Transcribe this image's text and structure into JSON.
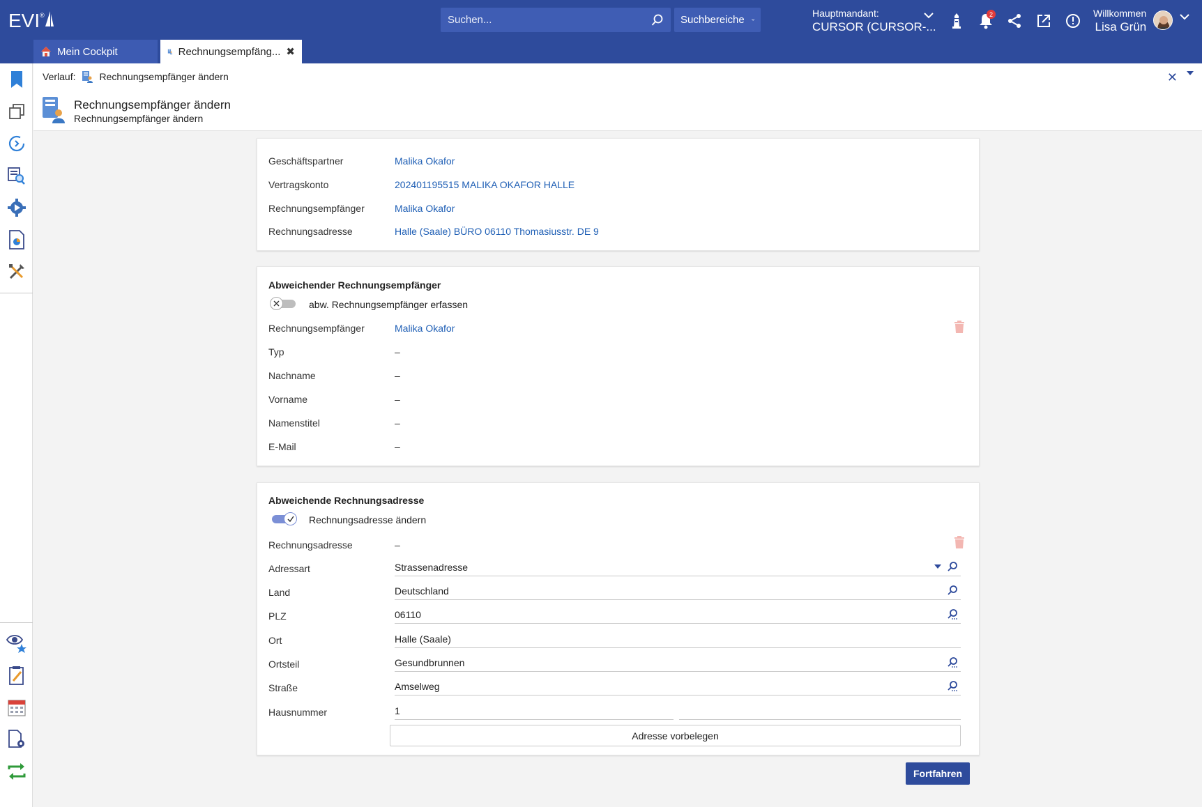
{
  "app": {
    "logo_text": "EVI",
    "logo_reg": "®",
    "search_placeholder": "Suchen...",
    "search_scope_label": "Suchbereiche",
    "mandant_label": "Hauptmandant:",
    "mandant_value": "CURSOR (CURSOR-...",
    "notification_count": "2",
    "welcome_label": "Willkommen",
    "user_name": "Lisa Grün"
  },
  "tabs": [
    {
      "label": "Mein Cockpit"
    },
    {
      "label": "Rechnungsempfäng..."
    }
  ],
  "header": {
    "breadcrumb_label": "Verlauf:",
    "breadcrumb_item": "Rechnungsempfänger ändern",
    "title": "Rechnungsempfänger ändern",
    "subtitle": "Rechnungsempfänger ändern"
  },
  "summary": {
    "rows": [
      {
        "label": "Geschäftspartner",
        "value": "Malika Okafor"
      },
      {
        "label": "Vertragskonto",
        "value": "202401195515 MALIKA OKAFOR HALLE"
      },
      {
        "label": "Rechnungsempfänger",
        "value": "Malika Okafor"
      },
      {
        "label": "Rechnungsadresse",
        "value": "Halle (Saale) BÜRO 06110 Thomasiusstr. DE 9"
      }
    ]
  },
  "recipient": {
    "title": "Abweichender Rechnungsempfänger",
    "toggle_label": "abw. Rechnungsempfänger erfassen",
    "toggle_on": false,
    "recipient_label": "Rechnungsempfänger",
    "recipient_value": "Malika Okafor",
    "rows": [
      {
        "label": "Typ",
        "value": "–"
      },
      {
        "label": "Nachname",
        "value": "–"
      },
      {
        "label": "Vorname",
        "value": "–"
      },
      {
        "label": "Namenstitel",
        "value": "–"
      },
      {
        "label": "E-Mail",
        "value": "–"
      }
    ]
  },
  "address": {
    "title": "Abweichende Rechnungsadresse",
    "toggle_label": "Rechnungsadresse ändern",
    "toggle_on": true,
    "address_label": "Rechnungsadresse",
    "address_value": "–",
    "fields": [
      {
        "label": "Adressart",
        "value": "Strassenadresse"
      },
      {
        "label": "Land",
        "value": "Deutschland"
      },
      {
        "label": "PLZ",
        "value": "06110"
      },
      {
        "label": "Ort",
        "value": "Halle (Saale)"
      },
      {
        "label": "Ortsteil",
        "value": "Gesundbrunnen"
      },
      {
        "label": "Straße",
        "value": "Amselweg"
      },
      {
        "label": "Hausnummer",
        "value": "1"
      }
    ],
    "prefill_label": "Adresse vorbelegen"
  },
  "actions": {
    "continue_label": "Fortfahren"
  },
  "colors": {
    "brand": "#2e4b9c",
    "link": "#1f5fb5",
    "toggle_on": "#7b8fd6",
    "toggle_off": "#bdbdbd"
  }
}
